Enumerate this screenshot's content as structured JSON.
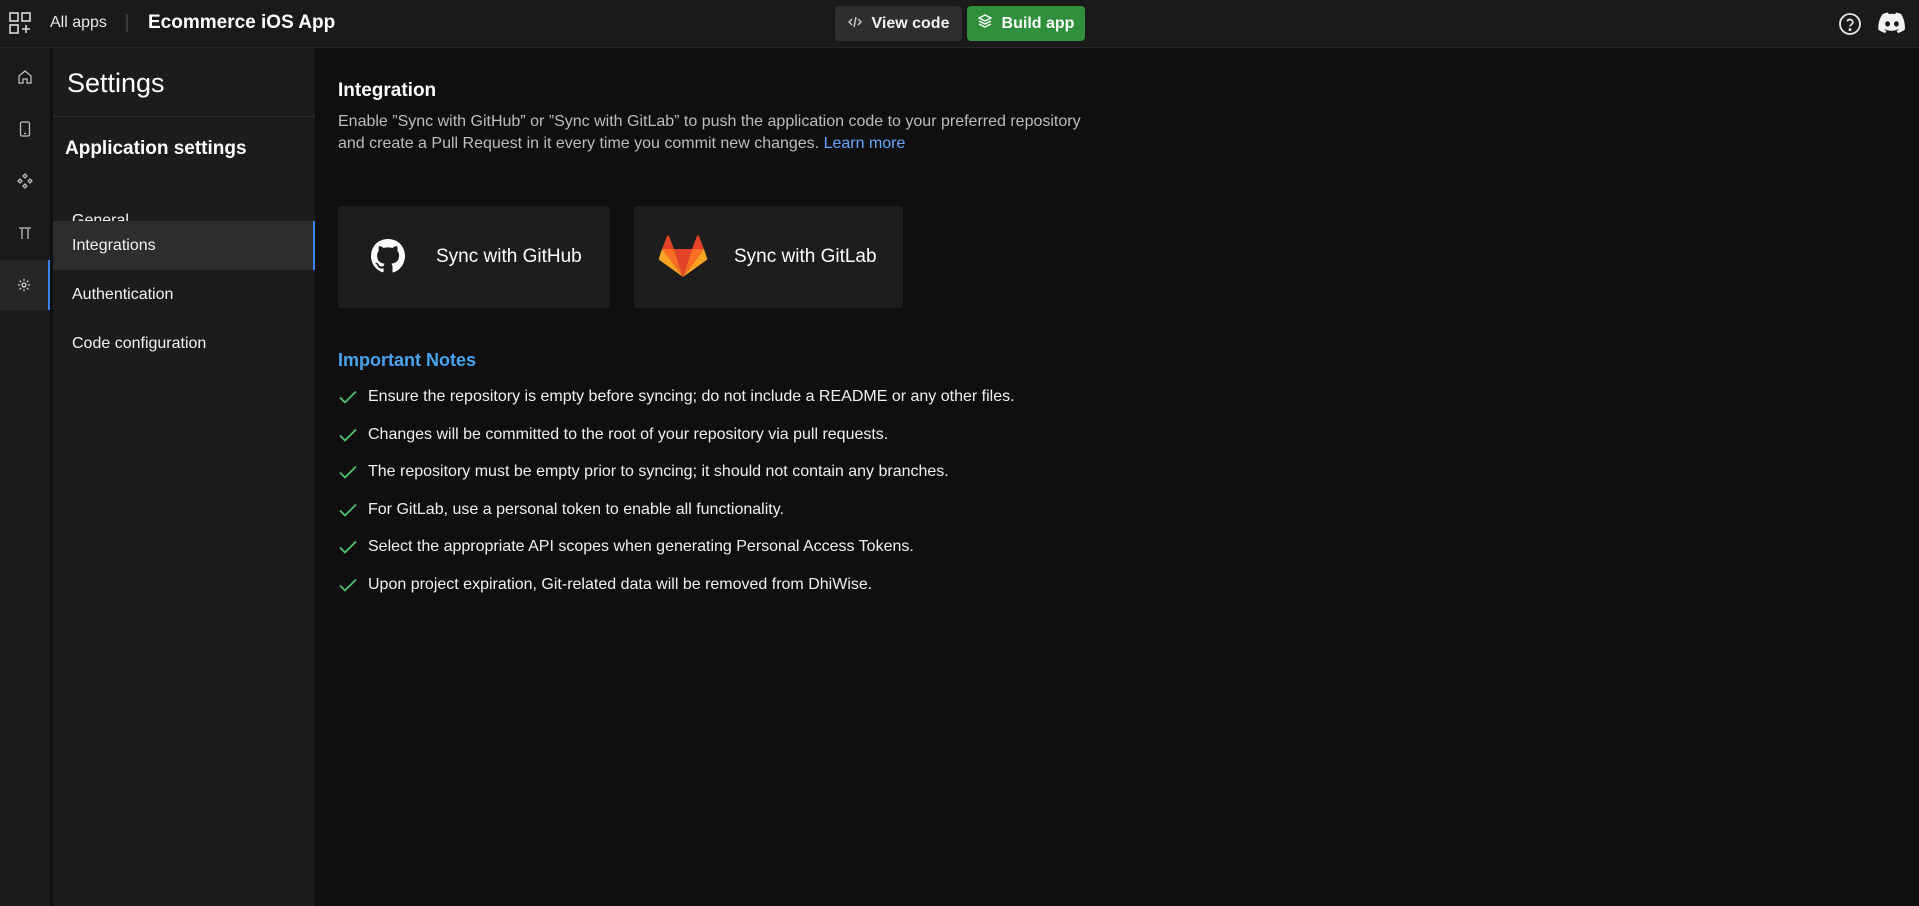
{
  "topbar": {
    "all_apps_label": "All apps",
    "app_title": "Ecommerce iOS App",
    "view_code_label": "View code",
    "build_app_label": "Build app",
    "icons": [
      "apps-grid-icon",
      "code-icon",
      "layers-icon",
      "help-icon",
      "discord-icon"
    ]
  },
  "rail": {
    "items": [
      "home-icon",
      "phone-icon",
      "components-icon",
      "pi-icon",
      "gear-icon"
    ],
    "active_index": 4
  },
  "sidebar": {
    "title": "Settings",
    "section_title": "Application settings",
    "items": [
      {
        "label": "General"
      },
      {
        "label": "Integrations",
        "active": true
      },
      {
        "label": "Authentication"
      },
      {
        "label": "Code configuration"
      }
    ]
  },
  "main": {
    "title": "Integration",
    "description": "Enable ”Sync with GitHub” or ”Sync with GitLab” to push the application code to your preferred repository and create a Pull Request in it every time you commit new changes.",
    "learn_more": "Learn more",
    "github_card_label": "Sync with GitHub",
    "gitlab_card_label": "Sync with GitLab",
    "notes_title": "Important Notes",
    "notes": [
      "Ensure the repository is empty before syncing; do not include a README or any other files.",
      "Changes will be committed to the root of your repository via pull requests.",
      "The repository must be empty prior to syncing; it should not contain any branches.",
      "For GitLab, use a personal token to enable all functionality.",
      "Select the appropriate API scopes when generating Personal Access Tokens.",
      "Upon project expiration, Git-related data will be removed from DhiWise."
    ]
  },
  "colors": {
    "accent_blue": "#3b82f6",
    "build_green": "#2f8f3a",
    "notes_blue": "#4aa3f0",
    "check_green": "#4ec36a"
  }
}
